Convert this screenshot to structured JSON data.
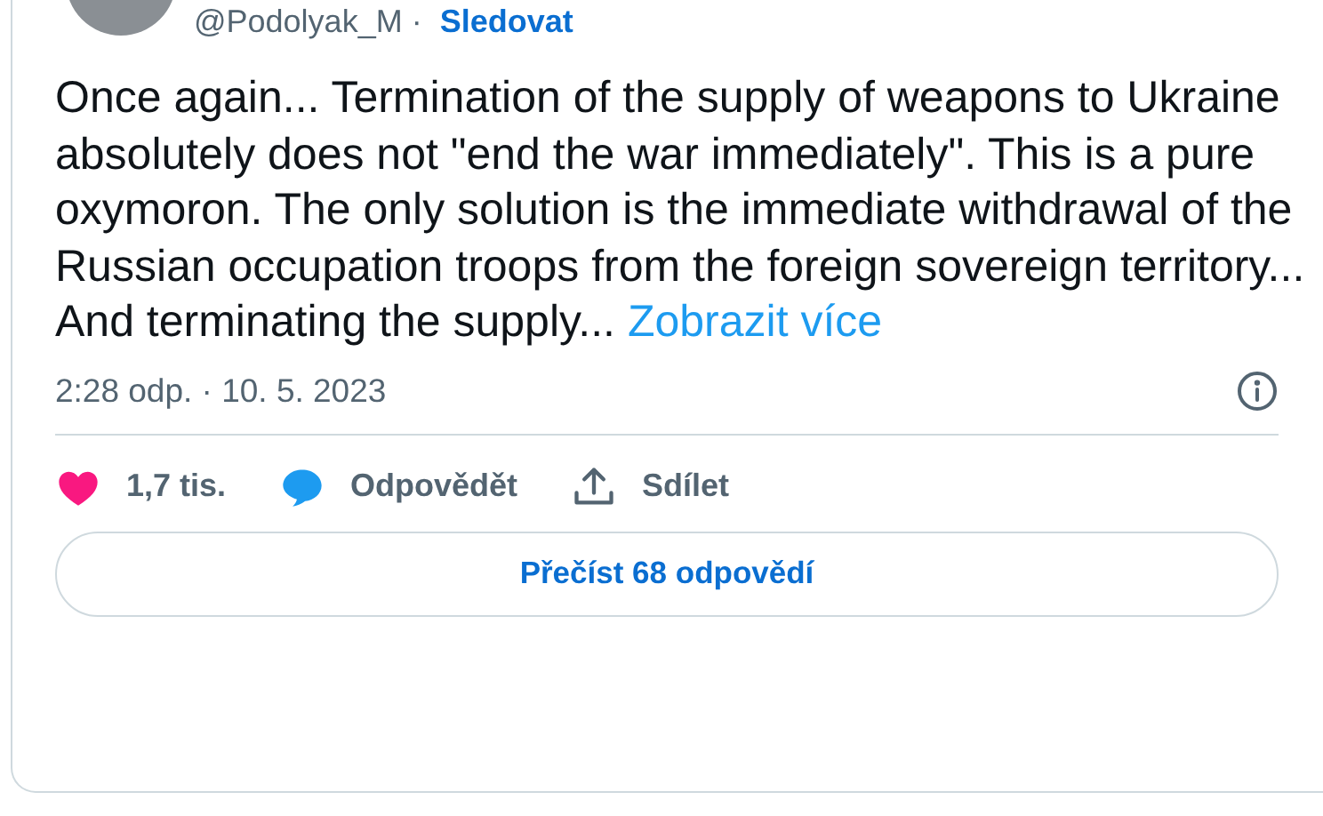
{
  "header": {
    "handle": "@Podolyak_M",
    "separator": "·",
    "follow": "Sledovat"
  },
  "tweet": {
    "text": "Once again... Termination of the supply of weapons to Ukraine absolutely does not \"end the war immediately\". This is a pure oxymoron. The only solution is the immediate withdrawal of the Russian occupation troops from the foreign sovereign territory... And terminating the supply...",
    "show_more": "Zobrazit více"
  },
  "timestamp": "2:28 odp. · 10. 5. 2023",
  "actions": [
    {
      "kind": "like",
      "label": "1,7 tis."
    },
    {
      "kind": "reply",
      "label": "Odpovědět"
    },
    {
      "kind": "share",
      "label": "Sdílet"
    }
  ],
  "replies_button": "Přečíst 68 odpovědí"
}
